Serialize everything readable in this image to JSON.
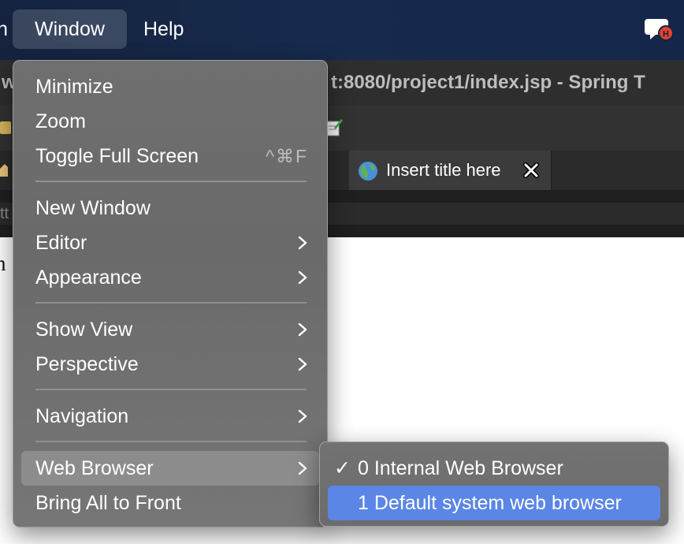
{
  "menubar": {
    "partial_left": "n",
    "items": [
      {
        "label": "Window",
        "active": true
      },
      {
        "label": "Help",
        "active": false
      }
    ],
    "tray_icon": "speech-bubble-notification-icon",
    "tray_badge": "H"
  },
  "window": {
    "title_left": "w",
    "title_right": "t:8080/project1/index.jsp - Spring T",
    "tab": {
      "label": "Insert title here",
      "icon": "globe-icon",
      "close_icon": "close-icon"
    },
    "address_partial": "tt",
    "content_partial": "n"
  },
  "menu": {
    "items": [
      {
        "label": "Minimize"
      },
      {
        "label": "Zoom"
      },
      {
        "label": "Toggle Full Screen",
        "shortcut": "^⌘F"
      },
      {
        "label": "New Window"
      },
      {
        "label": "Editor"
      },
      {
        "label": "Appearance"
      },
      {
        "label": "Show View"
      },
      {
        "label": "Perspective"
      },
      {
        "label": "Navigation"
      },
      {
        "label": "Web Browser"
      },
      {
        "label": "Bring All to Front"
      }
    ]
  },
  "submenu": {
    "items": [
      {
        "label": "0 Internal Web Browser",
        "checked": true,
        "check_mark": "✓"
      },
      {
        "label": "1 Default system web browser",
        "checked": false
      }
    ]
  },
  "colors": {
    "menubar_bg": "#15233f",
    "menu_bg": "#6f6f6f",
    "selection": "#5b86e5",
    "badge": "#e0432f"
  }
}
